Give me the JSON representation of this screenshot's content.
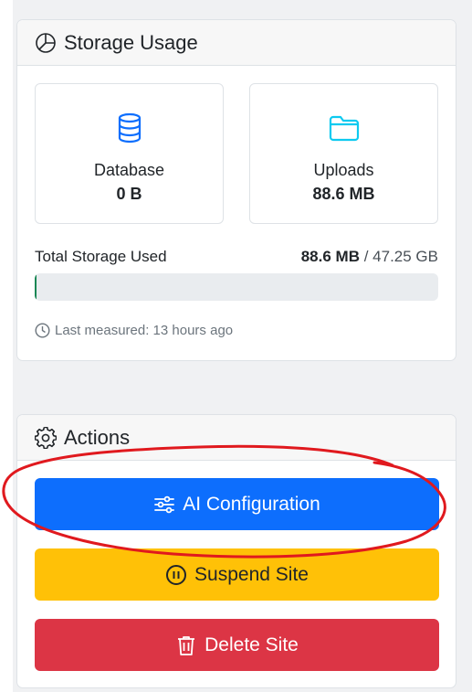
{
  "storage": {
    "title": "Storage Usage",
    "title_icon": "pie-chart-icon",
    "database": {
      "label": "Database",
      "value": "0 B",
      "icon": "database-icon",
      "icon_color": "#0d6efd"
    },
    "uploads": {
      "label": "Uploads",
      "value": "88.6 MB",
      "icon": "folder-icon",
      "icon_color": "#0dcaf0"
    },
    "total_label": "Total Storage Used",
    "total_used": "88.6 MB",
    "total_separator": "/",
    "total_capacity": "47.25 GB",
    "progress_fraction": 0.0018,
    "progress_color": "#198754",
    "last_measured": "Last measured: 13 hours ago"
  },
  "actions": {
    "title": "Actions",
    "title_icon": "gear-icon",
    "ai_button": "AI Configuration",
    "suspend_button": "Suspend Site",
    "delete_button": "Delete Site",
    "colors": {
      "primary": "#0d6efd",
      "warning": "#ffc107",
      "danger": "#dc3545"
    }
  },
  "annotation": {
    "type": "hand-drawn circle",
    "color": "#e0191e",
    "target": "ai-configuration-button"
  }
}
